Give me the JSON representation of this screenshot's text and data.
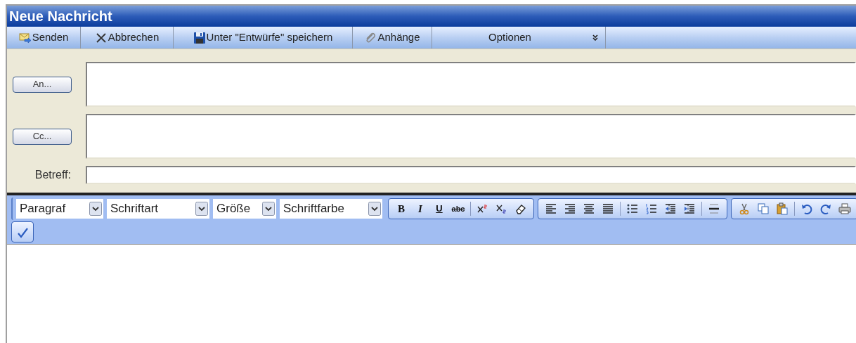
{
  "window": {
    "title": "Neue Nachricht"
  },
  "toolbar": [
    {
      "kind": "send",
      "label": "Senden"
    },
    {
      "kind": "cancel",
      "label": "Abbrechen"
    },
    {
      "kind": "save",
      "label": "Unter \"Entwürfe\" speichern"
    },
    {
      "kind": "attach",
      "label": "Anhänge"
    },
    {
      "kind": "options",
      "label": "Optionen"
    }
  ],
  "header": {
    "to_button": "An...",
    "cc_button": "Cc...",
    "subject_label": "Betreff:"
  },
  "editor": {
    "selects": [
      {
        "label": "Paragraf"
      },
      {
        "label": "Schriftart"
      },
      {
        "label": "Größe"
      },
      {
        "label": "Schriftfarbe"
      }
    ],
    "groups": [
      [
        {
          "kind": "bold",
          "label": "B"
        },
        {
          "kind": "italic",
          "label": "I"
        },
        {
          "kind": "underline",
          "label": "U"
        },
        {
          "kind": "strike",
          "label": "abc"
        },
        {
          "kind": "sep"
        },
        {
          "kind": "superscript"
        },
        {
          "kind": "subscript"
        },
        {
          "kind": "eraser"
        }
      ],
      [
        {
          "kind": "align-left"
        },
        {
          "kind": "align-right"
        },
        {
          "kind": "align-center"
        },
        {
          "kind": "justify"
        },
        {
          "kind": "sep"
        },
        {
          "kind": "bullets"
        },
        {
          "kind": "numbers"
        },
        {
          "kind": "outdent"
        },
        {
          "kind": "indent"
        },
        {
          "kind": "sep"
        },
        {
          "kind": "rule"
        }
      ],
      [
        {
          "kind": "cut"
        },
        {
          "kind": "copy"
        },
        {
          "kind": "paste"
        },
        {
          "kind": "sep"
        },
        {
          "kind": "undo"
        },
        {
          "kind": "redo"
        },
        {
          "kind": "print"
        }
      ],
      [
        {
          "kind": "spellcheck"
        }
      ]
    ]
  }
}
